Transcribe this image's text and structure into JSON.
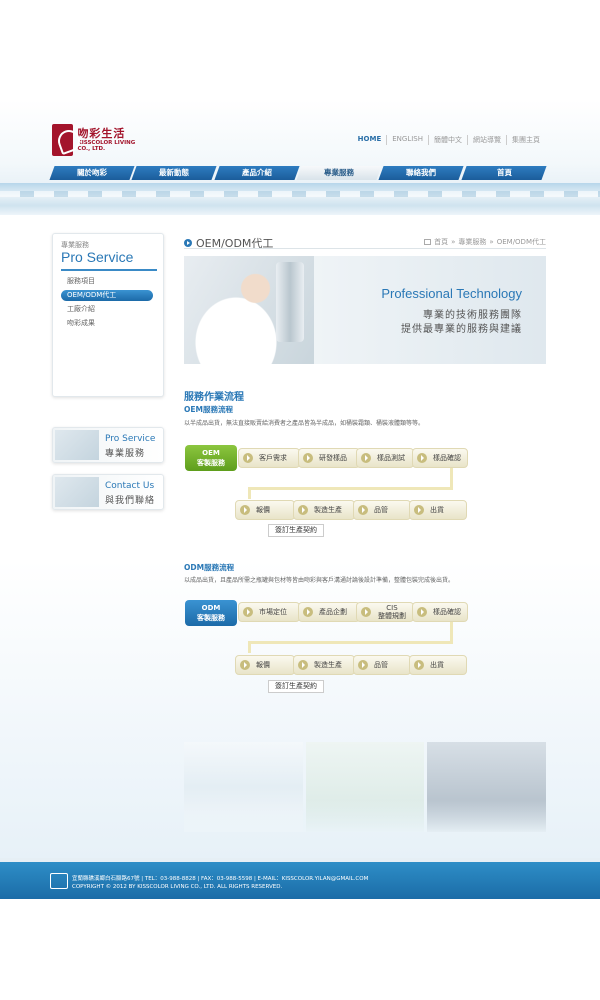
{
  "brand": {
    "name_cn": "吻彩生活",
    "name_en": "KISSCOLOR LIVING CO., LTD."
  },
  "top_links": [
    "HOME",
    "ENGLISH",
    "簡體中文",
    "網站導覽",
    "集團主頁"
  ],
  "nav": {
    "items": [
      {
        "label": "關於吻彩"
      },
      {
        "label": "最新動態"
      },
      {
        "label": "產品介紹"
      },
      {
        "label": "專業服務"
      },
      {
        "label": "聯絡我們"
      },
      {
        "label": "首頁"
      }
    ],
    "active_index": 3
  },
  "sidebar": {
    "category": "專業服務",
    "title": "Pro Service",
    "items": [
      {
        "label": "服務項目"
      },
      {
        "label": "OEM/ODM代工"
      },
      {
        "label": "工廠介紹"
      },
      {
        "label": "吻彩成果"
      }
    ],
    "active_index": 1
  },
  "promos": [
    {
      "en": "Pro Service",
      "cn": "專業服務"
    },
    {
      "en": "Contact Us",
      "cn": "與我們聯絡"
    }
  ],
  "page": {
    "title": "OEM/ODM代工",
    "breadcrumb": [
      "首頁",
      "專業服務",
      "OEM/ODM代工"
    ],
    "breadcrumb_sep": "»"
  },
  "banner": {
    "en": "Professional Technology",
    "cn1": "專業的技術服務團隊",
    "cn2": "提供最專業的服務與建議"
  },
  "process": {
    "title": "服務作業流程",
    "oem": {
      "title": "OEM服務流程",
      "desc": "以半成品出貨，無法直接販賣給消費者之產品皆為半成品，如桶裝霜類、桶裝液體類等等。",
      "label_top": "OEM",
      "label_bottom": "客製服務",
      "row1": [
        "客戶需求",
        "研發樣品",
        "樣品測試",
        "樣品確認"
      ],
      "row2": [
        "報價",
        "製造生產",
        "品管",
        "出貨"
      ],
      "contract": "簽訂生產契約"
    },
    "odm": {
      "title": "ODM服務流程",
      "desc": "以成品出貨，且產品所需之瓶罐與包材等皆由吻彩與客戶溝通討論後設計準備，整體包裝完成後出貨。",
      "label_top": "ODM",
      "label_bottom": "客製服務",
      "row1": [
        "市場定位",
        "產品企劃",
        "CIS 整體規劃",
        "樣品確認"
      ],
      "row1_cis_top": "CIS",
      "row1_cis_bottom": "整體規劃",
      "row2": [
        "報價",
        "製造生產",
        "品管",
        "出貨"
      ],
      "contract": "簽訂生產契約"
    }
  },
  "footer": {
    "line1": "宜蘭縣礁溪鄉白石腳路67號 | TEL：03-988-8828 | FAX：03-988-5598 | E-MAIL：KISSCOLOR.YILAN@GMAIL.COM",
    "line2": "COPYRIGHT © 2012 BY KISSCOLOR LIVING CO., LTD. ALL RIGHTS RESERVED."
  },
  "colors": {
    "brand_red": "#a3142b",
    "accent_blue": "#2a78b6",
    "oem_green": "#6fae27",
    "step_beige": "#efe7b8"
  },
  "icons": {
    "title_bullet": "circle-arrow-icon",
    "breadcrumb_home": "home-icon",
    "step_arrow": "chevron-right-circle-icon"
  }
}
